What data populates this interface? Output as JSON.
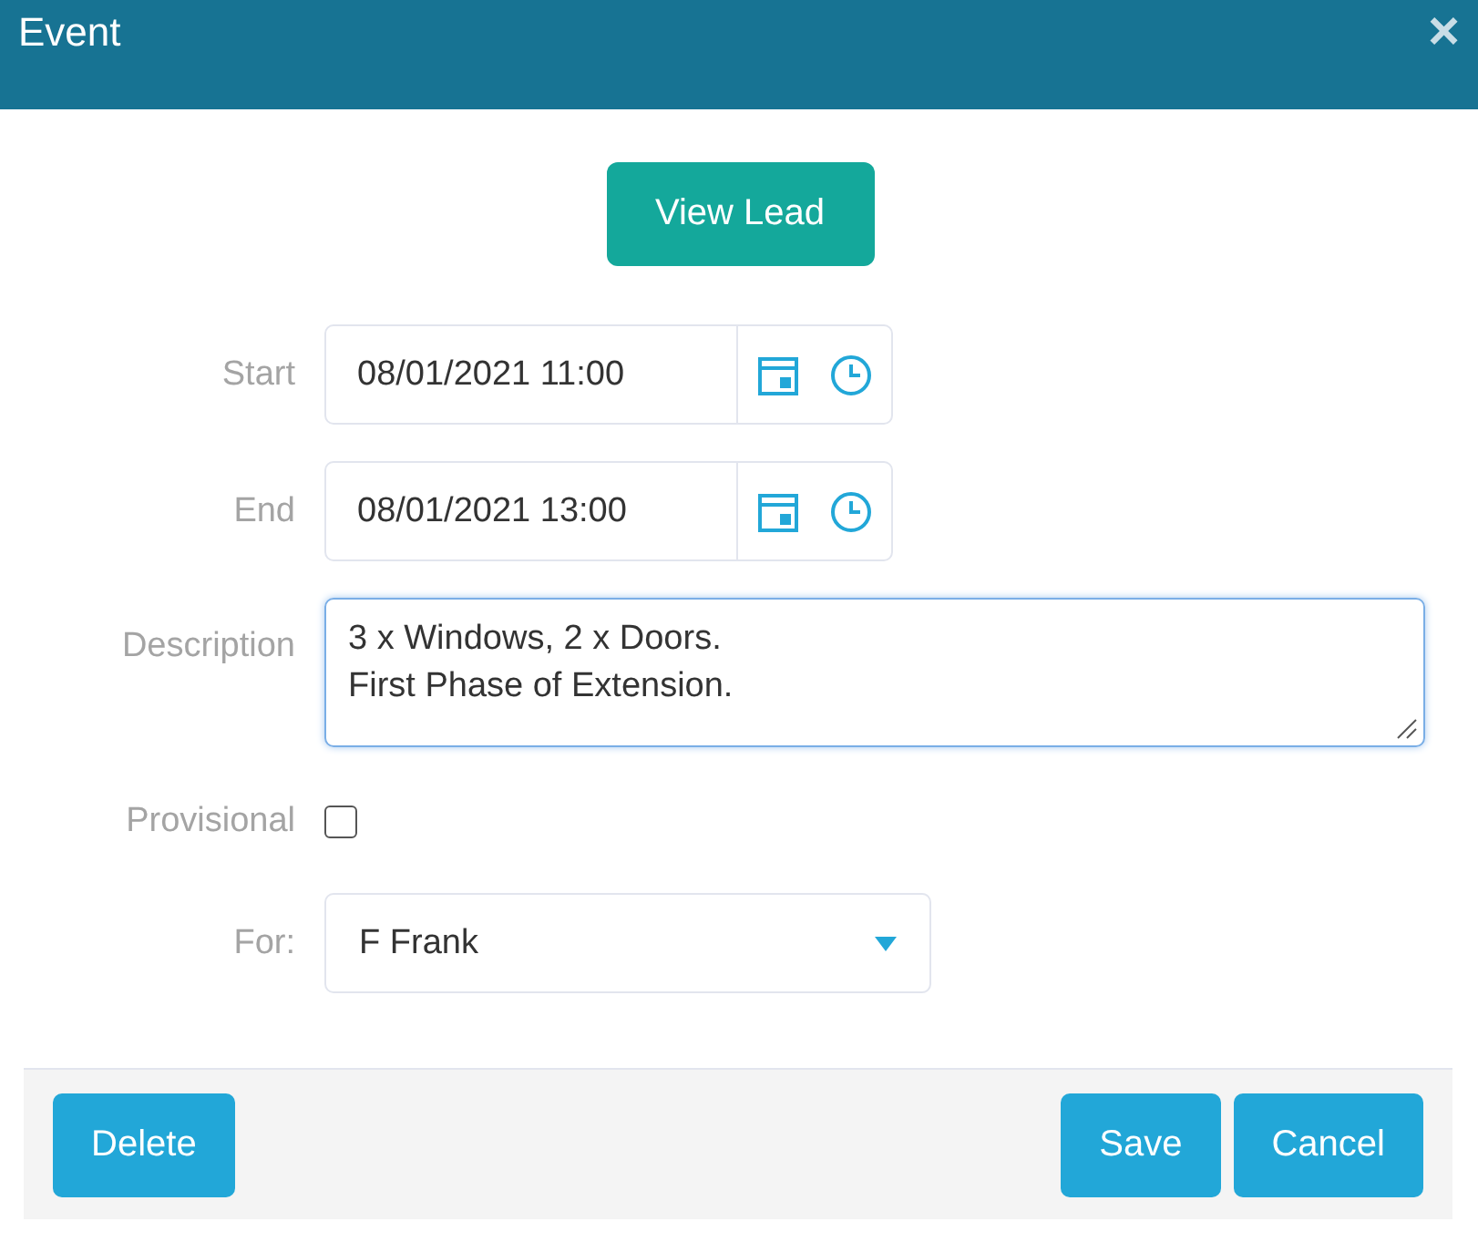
{
  "window": {
    "title": "Event",
    "close": "×"
  },
  "view_lead_button": "View Lead",
  "fields": [
    {
      "kind": "datetime",
      "label": "Start",
      "value": "08/01/2021 11:00"
    },
    {
      "kind": "datetime",
      "label": "End",
      "value": "08/01/2021 13:00"
    },
    {
      "kind": "textarea",
      "label": "Description",
      "value": "3 x Windows, 2 x Doors.\nFirst Phase of Extension.",
      "focused": true
    },
    {
      "kind": "checkbox",
      "label": "Provisional",
      "checked": false
    },
    {
      "kind": "select",
      "label": "For:",
      "value": "F Frank"
    }
  ],
  "footer": {
    "left_buttons": [
      "Delete"
    ],
    "right_buttons": [
      "Save",
      "Cancel"
    ]
  }
}
